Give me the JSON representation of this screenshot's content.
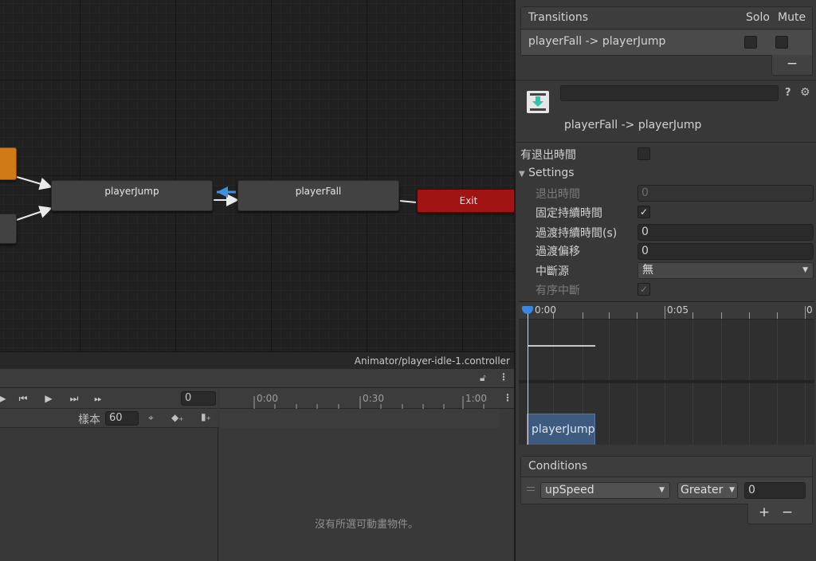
{
  "graph": {
    "states": {
      "jump": "playerJump",
      "fall": "playerFall",
      "exit": "Exit"
    },
    "footer_path": "Animator/player-idle-1.controller"
  },
  "animation": {
    "frame_value": "0",
    "ruler_labels": [
      "0:00",
      "0:30",
      "1:00"
    ],
    "sample_label": "樣本",
    "sample_value": "60",
    "empty_message": "沒有所選可動畫物件。"
  },
  "inspector": {
    "transitions": {
      "header": "Transitions",
      "solo_label": "Solo",
      "mute_label": "Mute",
      "row_name": "playerFall -> playerJump",
      "remove_label": "−"
    },
    "title_field_value": "",
    "subtitle": "playerFall -> playerJump",
    "has_exit_time_label": "有退出時間",
    "has_exit_time_checked": false,
    "settings_label": "Settings",
    "exit_time_label": "退出時間",
    "exit_time_value": "0",
    "fixed_duration_label": "固定持續時間",
    "fixed_duration_checked": true,
    "transition_duration_label": "過渡持續時間(s)",
    "transition_duration_value": "0",
    "transition_offset_label": "過渡偏移",
    "transition_offset_value": "0",
    "interruption_source_label": "中斷源",
    "interruption_source_value": "無",
    "ordered_interruption_label": "有序中斷",
    "ordered_interruption_checked": true,
    "preview": {
      "ruler_labels": [
        "0:00",
        "0:05",
        "0"
      ],
      "clip_name": "playerJump"
    },
    "conditions": {
      "header": "Conditions",
      "parameter": "upSpeed",
      "mode": "Greater",
      "threshold": "0",
      "add_label": "+",
      "remove_label": "−"
    }
  },
  "colors": {
    "orange_state": "#cf7a16",
    "exit_state": "#a11414",
    "highlight_arrow": "#3d8fe0",
    "clip_block": "#3e5a7e"
  }
}
